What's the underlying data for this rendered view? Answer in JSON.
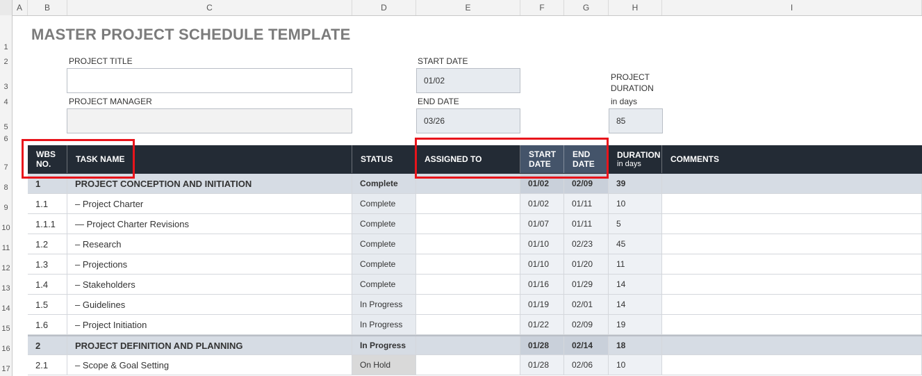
{
  "columns": [
    "A",
    "B",
    "C",
    "D",
    "E",
    "F",
    "G",
    "H",
    "I"
  ],
  "row_numbers": [
    "1",
    "2",
    "3",
    "4",
    "5",
    "6",
    "7",
    "8",
    "9",
    "10",
    "11",
    "12",
    "13",
    "14",
    "15",
    "16",
    "17"
  ],
  "title": "MASTER PROJECT SCHEDULE TEMPLATE",
  "project": {
    "title_label": "PROJECT TITLE",
    "title_value": "",
    "manager_label": "PROJECT MANAGER",
    "manager_value": "",
    "start_label": "START DATE",
    "start_value": "01/02",
    "end_label": "END DATE",
    "end_value": "03/26",
    "duration_label_1": "PROJECT",
    "duration_label_2": "DURATION",
    "duration_label_3": "in days",
    "duration_value": "85"
  },
  "table_header": {
    "wbs_1": "WBS",
    "wbs_2": "NO.",
    "task": "TASK NAME",
    "status": "STATUS",
    "assigned": "ASSIGNED TO",
    "start_1": "START",
    "start_2": "DATE",
    "end_1": "END",
    "end_2": "DATE",
    "duration_1": "DURATION",
    "duration_2": "in days",
    "comments": "COMMENTS"
  },
  "rows": [
    {
      "wbs": "1",
      "task": "PROJECT CONCEPTION AND INITIATION",
      "status": "Complete",
      "assigned": "",
      "start": "01/02",
      "end": "02/09",
      "duration": "39",
      "section": true
    },
    {
      "wbs": "1.1",
      "task": "– Project Charter",
      "status": "Complete",
      "assigned": "",
      "start": "01/02",
      "end": "01/11",
      "duration": "10",
      "section": false
    },
    {
      "wbs": "1.1.1",
      "task": "— Project Charter Revisions",
      "status": "Complete",
      "assigned": "",
      "start": "01/07",
      "end": "01/11",
      "duration": "5",
      "section": false
    },
    {
      "wbs": "1.2",
      "task": "– Research",
      "status": "Complete",
      "assigned": "",
      "start": "01/10",
      "end": "02/23",
      "duration": "45",
      "section": false
    },
    {
      "wbs": "1.3",
      "task": "– Projections",
      "status": "Complete",
      "assigned": "",
      "start": "01/10",
      "end": "01/20",
      "duration": "11",
      "section": false
    },
    {
      "wbs": "1.4",
      "task": "– Stakeholders",
      "status": "Complete",
      "assigned": "",
      "start": "01/16",
      "end": "01/29",
      "duration": "14",
      "section": false
    },
    {
      "wbs": "1.5",
      "task": "– Guidelines",
      "status": "In Progress",
      "assigned": "",
      "start": "01/19",
      "end": "02/01",
      "duration": "14",
      "section": false
    },
    {
      "wbs": "1.6",
      "task": "– Project Initiation",
      "status": "In Progress",
      "assigned": "",
      "start": "01/22",
      "end": "02/09",
      "duration": "19",
      "section": false
    },
    {
      "wbs": "2",
      "task": "PROJECT DEFINITION AND PLANNING",
      "status": "In Progress",
      "assigned": "",
      "start": "01/28",
      "end": "02/14",
      "duration": "18",
      "section": true
    },
    {
      "wbs": "2.1",
      "task": "– Scope & Goal Setting",
      "status": "On Hold",
      "assigned": "",
      "start": "01/28",
      "end": "02/06",
      "duration": "10",
      "section": false
    }
  ],
  "colors": {
    "header_dark": "#232b35",
    "header_date": "#44546a",
    "section_fill": "#d6dce4",
    "highlight_red": "#e8141b"
  }
}
